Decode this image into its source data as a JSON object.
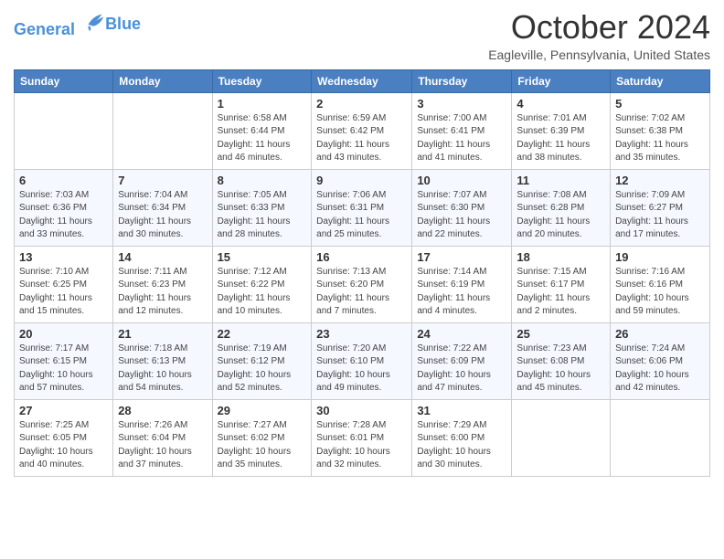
{
  "header": {
    "logo_line1": "General",
    "logo_line2": "Blue",
    "month": "October 2024",
    "location": "Eagleville, Pennsylvania, United States"
  },
  "days_of_week": [
    "Sunday",
    "Monday",
    "Tuesday",
    "Wednesday",
    "Thursday",
    "Friday",
    "Saturday"
  ],
  "weeks": [
    [
      {
        "day": "",
        "sunrise": "",
        "sunset": "",
        "daylight": ""
      },
      {
        "day": "",
        "sunrise": "",
        "sunset": "",
        "daylight": ""
      },
      {
        "day": "1",
        "sunrise": "Sunrise: 6:58 AM",
        "sunset": "Sunset: 6:44 PM",
        "daylight": "Daylight: 11 hours and 46 minutes."
      },
      {
        "day": "2",
        "sunrise": "Sunrise: 6:59 AM",
        "sunset": "Sunset: 6:42 PM",
        "daylight": "Daylight: 11 hours and 43 minutes."
      },
      {
        "day": "3",
        "sunrise": "Sunrise: 7:00 AM",
        "sunset": "Sunset: 6:41 PM",
        "daylight": "Daylight: 11 hours and 41 minutes."
      },
      {
        "day": "4",
        "sunrise": "Sunrise: 7:01 AM",
        "sunset": "Sunset: 6:39 PM",
        "daylight": "Daylight: 11 hours and 38 minutes."
      },
      {
        "day": "5",
        "sunrise": "Sunrise: 7:02 AM",
        "sunset": "Sunset: 6:38 PM",
        "daylight": "Daylight: 11 hours and 35 minutes."
      }
    ],
    [
      {
        "day": "6",
        "sunrise": "Sunrise: 7:03 AM",
        "sunset": "Sunset: 6:36 PM",
        "daylight": "Daylight: 11 hours and 33 minutes."
      },
      {
        "day": "7",
        "sunrise": "Sunrise: 7:04 AM",
        "sunset": "Sunset: 6:34 PM",
        "daylight": "Daylight: 11 hours and 30 minutes."
      },
      {
        "day": "8",
        "sunrise": "Sunrise: 7:05 AM",
        "sunset": "Sunset: 6:33 PM",
        "daylight": "Daylight: 11 hours and 28 minutes."
      },
      {
        "day": "9",
        "sunrise": "Sunrise: 7:06 AM",
        "sunset": "Sunset: 6:31 PM",
        "daylight": "Daylight: 11 hours and 25 minutes."
      },
      {
        "day": "10",
        "sunrise": "Sunrise: 7:07 AM",
        "sunset": "Sunset: 6:30 PM",
        "daylight": "Daylight: 11 hours and 22 minutes."
      },
      {
        "day": "11",
        "sunrise": "Sunrise: 7:08 AM",
        "sunset": "Sunset: 6:28 PM",
        "daylight": "Daylight: 11 hours and 20 minutes."
      },
      {
        "day": "12",
        "sunrise": "Sunrise: 7:09 AM",
        "sunset": "Sunset: 6:27 PM",
        "daylight": "Daylight: 11 hours and 17 minutes."
      }
    ],
    [
      {
        "day": "13",
        "sunrise": "Sunrise: 7:10 AM",
        "sunset": "Sunset: 6:25 PM",
        "daylight": "Daylight: 11 hours and 15 minutes."
      },
      {
        "day": "14",
        "sunrise": "Sunrise: 7:11 AM",
        "sunset": "Sunset: 6:23 PM",
        "daylight": "Daylight: 11 hours and 12 minutes."
      },
      {
        "day": "15",
        "sunrise": "Sunrise: 7:12 AM",
        "sunset": "Sunset: 6:22 PM",
        "daylight": "Daylight: 11 hours and 10 minutes."
      },
      {
        "day": "16",
        "sunrise": "Sunrise: 7:13 AM",
        "sunset": "Sunset: 6:20 PM",
        "daylight": "Daylight: 11 hours and 7 minutes."
      },
      {
        "day": "17",
        "sunrise": "Sunrise: 7:14 AM",
        "sunset": "Sunset: 6:19 PM",
        "daylight": "Daylight: 11 hours and 4 minutes."
      },
      {
        "day": "18",
        "sunrise": "Sunrise: 7:15 AM",
        "sunset": "Sunset: 6:17 PM",
        "daylight": "Daylight: 11 hours and 2 minutes."
      },
      {
        "day": "19",
        "sunrise": "Sunrise: 7:16 AM",
        "sunset": "Sunset: 6:16 PM",
        "daylight": "Daylight: 10 hours and 59 minutes."
      }
    ],
    [
      {
        "day": "20",
        "sunrise": "Sunrise: 7:17 AM",
        "sunset": "Sunset: 6:15 PM",
        "daylight": "Daylight: 10 hours and 57 minutes."
      },
      {
        "day": "21",
        "sunrise": "Sunrise: 7:18 AM",
        "sunset": "Sunset: 6:13 PM",
        "daylight": "Daylight: 10 hours and 54 minutes."
      },
      {
        "day": "22",
        "sunrise": "Sunrise: 7:19 AM",
        "sunset": "Sunset: 6:12 PM",
        "daylight": "Daylight: 10 hours and 52 minutes."
      },
      {
        "day": "23",
        "sunrise": "Sunrise: 7:20 AM",
        "sunset": "Sunset: 6:10 PM",
        "daylight": "Daylight: 10 hours and 49 minutes."
      },
      {
        "day": "24",
        "sunrise": "Sunrise: 7:22 AM",
        "sunset": "Sunset: 6:09 PM",
        "daylight": "Daylight: 10 hours and 47 minutes."
      },
      {
        "day": "25",
        "sunrise": "Sunrise: 7:23 AM",
        "sunset": "Sunset: 6:08 PM",
        "daylight": "Daylight: 10 hours and 45 minutes."
      },
      {
        "day": "26",
        "sunrise": "Sunrise: 7:24 AM",
        "sunset": "Sunset: 6:06 PM",
        "daylight": "Daylight: 10 hours and 42 minutes."
      }
    ],
    [
      {
        "day": "27",
        "sunrise": "Sunrise: 7:25 AM",
        "sunset": "Sunset: 6:05 PM",
        "daylight": "Daylight: 10 hours and 40 minutes."
      },
      {
        "day": "28",
        "sunrise": "Sunrise: 7:26 AM",
        "sunset": "Sunset: 6:04 PM",
        "daylight": "Daylight: 10 hours and 37 minutes."
      },
      {
        "day": "29",
        "sunrise": "Sunrise: 7:27 AM",
        "sunset": "Sunset: 6:02 PM",
        "daylight": "Daylight: 10 hours and 35 minutes."
      },
      {
        "day": "30",
        "sunrise": "Sunrise: 7:28 AM",
        "sunset": "Sunset: 6:01 PM",
        "daylight": "Daylight: 10 hours and 32 minutes."
      },
      {
        "day": "31",
        "sunrise": "Sunrise: 7:29 AM",
        "sunset": "Sunset: 6:00 PM",
        "daylight": "Daylight: 10 hours and 30 minutes."
      },
      {
        "day": "",
        "sunrise": "",
        "sunset": "",
        "daylight": ""
      },
      {
        "day": "",
        "sunrise": "",
        "sunset": "",
        "daylight": ""
      }
    ]
  ]
}
